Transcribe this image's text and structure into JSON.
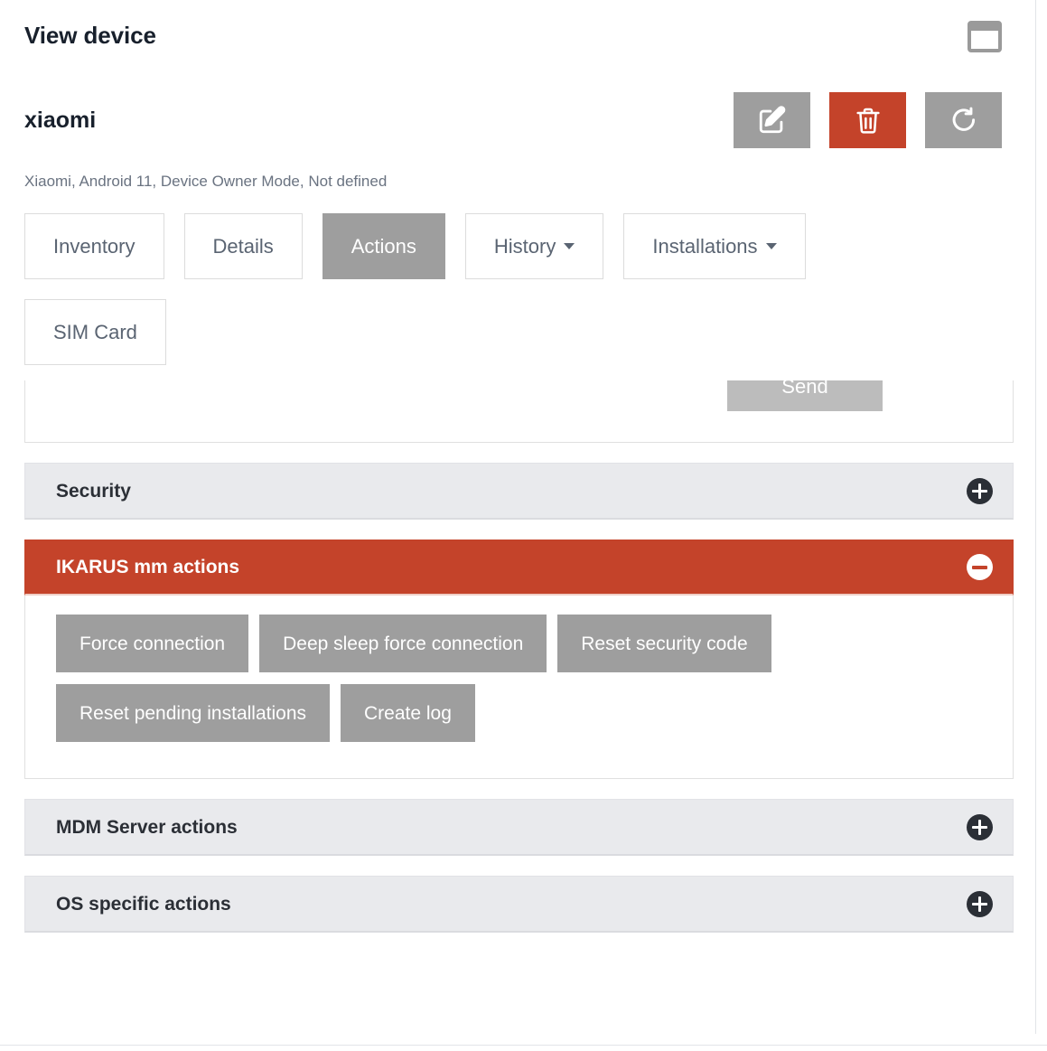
{
  "header": {
    "title": "View device",
    "window_icon": "window-restore-icon"
  },
  "device": {
    "name": "xiaomi",
    "meta": "Xiaomi, Android 11, Device Owner Mode, Not defined",
    "actions": [
      {
        "name": "edit-device-button",
        "icon": "edit-pencil-square-icon",
        "style": "gray"
      },
      {
        "name": "delete-device-button",
        "icon": "trash-icon",
        "style": "red"
      },
      {
        "name": "refresh-device-button",
        "icon": "refresh-icon",
        "style": "gray"
      }
    ]
  },
  "tabs": [
    {
      "label": "Inventory",
      "active": false,
      "caret": false
    },
    {
      "label": "Details",
      "active": false,
      "caret": false
    },
    {
      "label": "Actions",
      "active": true,
      "caret": false
    },
    {
      "label": "History",
      "active": false,
      "caret": true
    },
    {
      "label": "Installations",
      "active": false,
      "caret": true
    },
    {
      "label": "SIM Card",
      "active": false,
      "caret": false
    }
  ],
  "clipped_panel": {
    "send_label": "Send"
  },
  "panels": [
    {
      "title": "Security",
      "expanded": false,
      "toggle_icon": "plus-circle-icon",
      "buttons": []
    },
    {
      "title": "IKARUS mm actions",
      "expanded": true,
      "toggle_icon": "minus-circle-icon",
      "buttons": [
        "Force connection",
        "Deep sleep force connection",
        "Reset security code",
        "Reset pending installations",
        "Create log"
      ]
    },
    {
      "title": "MDM Server actions",
      "expanded": false,
      "toggle_icon": "plus-circle-icon",
      "buttons": []
    },
    {
      "title": "OS specific actions",
      "expanded": false,
      "toggle_icon": "plus-circle-icon",
      "buttons": []
    }
  ],
  "colors": {
    "accent_red": "#c4432a",
    "button_gray": "#9e9e9e",
    "panel_gray": "#e9eaed",
    "title_dark": "#18202c",
    "meta_gray": "#6a7381"
  }
}
